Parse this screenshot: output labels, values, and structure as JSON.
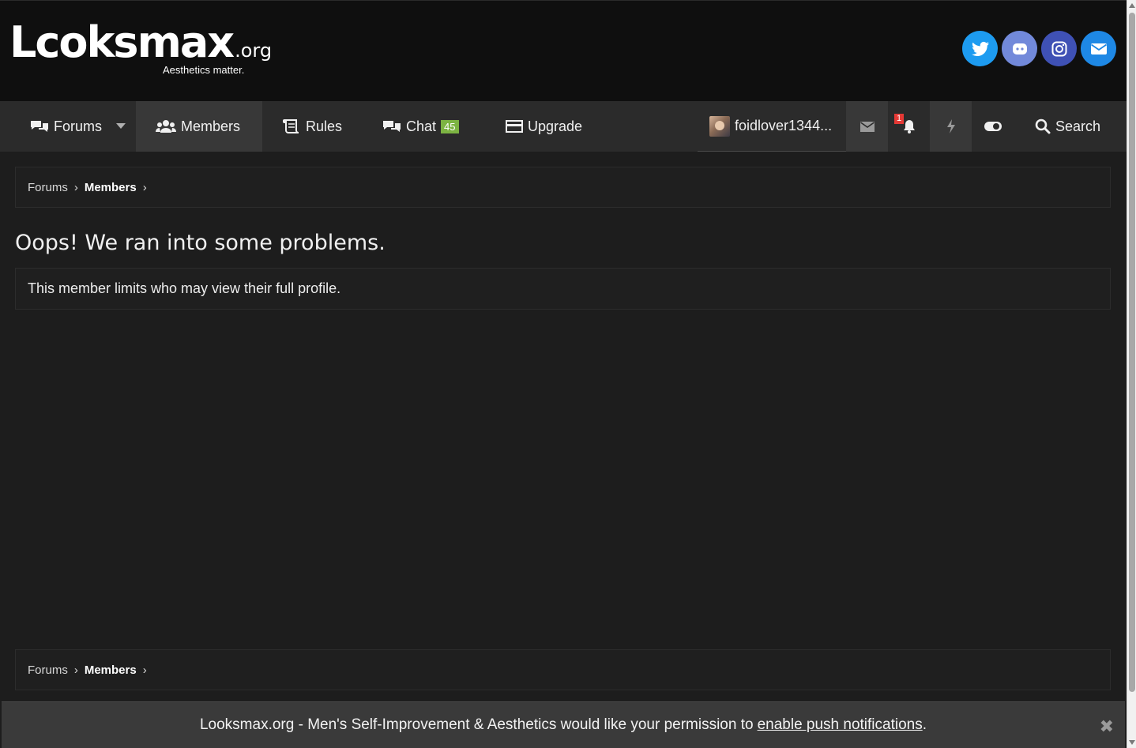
{
  "header": {
    "logo_text": "Lcoksmax",
    "logo_suffix": ".org",
    "tagline": "Aesthetics matter.",
    "social": [
      {
        "icon": "twitter-icon",
        "color": "#1d9bf0"
      },
      {
        "icon": "discord-icon",
        "color": "#7289da"
      },
      {
        "icon": "instagram-icon",
        "color": "#3f51b5"
      },
      {
        "icon": "email-icon",
        "color": "#1e88e5"
      }
    ]
  },
  "nav": {
    "forums": "Forums",
    "members": "Members",
    "rules": "Rules",
    "chat": "Chat",
    "chat_count": "45",
    "upgrade": "Upgrade",
    "username": "foidlover1344...",
    "alerts_count": "1",
    "search": "Search"
  },
  "breadcrumb": {
    "forums": "Forums",
    "members": "Members"
  },
  "main": {
    "title": "Oops! We ran into some problems.",
    "message": "This member limits who may view their full profile."
  },
  "push": {
    "text": "Looksmax.org - Men's Self-Improvement & Aesthetics would like your permission to",
    "link": "enable push notifications",
    "period": ".",
    "close": "✖"
  },
  "colors": {
    "header_bg": "#0f0f0f",
    "nav_bg": "#2b2b2b",
    "page_bg": "#1d1d1d",
    "chat_badge": "#7cb342",
    "alert_badge": "#e53935"
  }
}
